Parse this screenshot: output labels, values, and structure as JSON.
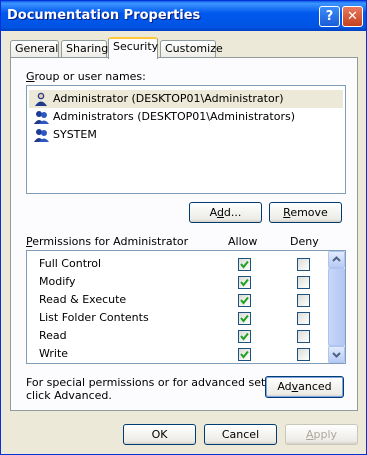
{
  "window": {
    "title": "Documentation Properties"
  },
  "titlebar": {
    "help_glyph": "?",
    "close_glyph": "✕"
  },
  "tabs": [
    {
      "label": "General"
    },
    {
      "label": "Sharing"
    },
    {
      "label": "Security",
      "active": true
    },
    {
      "label": "Customize"
    }
  ],
  "security": {
    "group_label_mnemonic": "G",
    "group_label_rest": "roup or user names:",
    "users": [
      {
        "name": "Administrator (DESKTOP01\\Administrator)",
        "icon": "user-icon",
        "selected": true
      },
      {
        "name": "Administrators (DESKTOP01\\Administrators)",
        "icon": "group-icon"
      },
      {
        "name": "SYSTEM",
        "icon": "group-icon"
      }
    ],
    "add_button": {
      "pre": "A",
      "mnemonic": "d",
      "post": "d..."
    },
    "remove_button": {
      "mnemonic": "R",
      "post": "emove"
    },
    "permissions_label_mnemonic": "P",
    "permissions_label_rest": "ermissions for Administrator",
    "allow_header": "Allow",
    "deny_header": "Deny",
    "permissions": [
      {
        "name": "Full Control",
        "allow": true,
        "deny": false
      },
      {
        "name": "Modify",
        "allow": true,
        "deny": false
      },
      {
        "name": "Read & Execute",
        "allow": true,
        "deny": false
      },
      {
        "name": "List Folder Contents",
        "allow": true,
        "deny": false
      },
      {
        "name": "Read",
        "allow": true,
        "deny": false
      },
      {
        "name": "Write",
        "allow": true,
        "deny": false
      }
    ],
    "special_text_line1": "For special permissions or for advanced settings,",
    "special_text_line2": "click Advanced.",
    "advanced_button": {
      "pre": "Ad",
      "mnemonic": "v",
      "post": "anced"
    }
  },
  "footer": {
    "ok_label": "OK",
    "cancel_label": "Cancel",
    "apply_button": {
      "mnemonic": "A",
      "post": "pply"
    }
  },
  "colors": {
    "title_bar": "#0054E3",
    "dialog_bg": "#ECE9D8",
    "check": "#21A121",
    "tab_highlight": "#FFC83C"
  }
}
